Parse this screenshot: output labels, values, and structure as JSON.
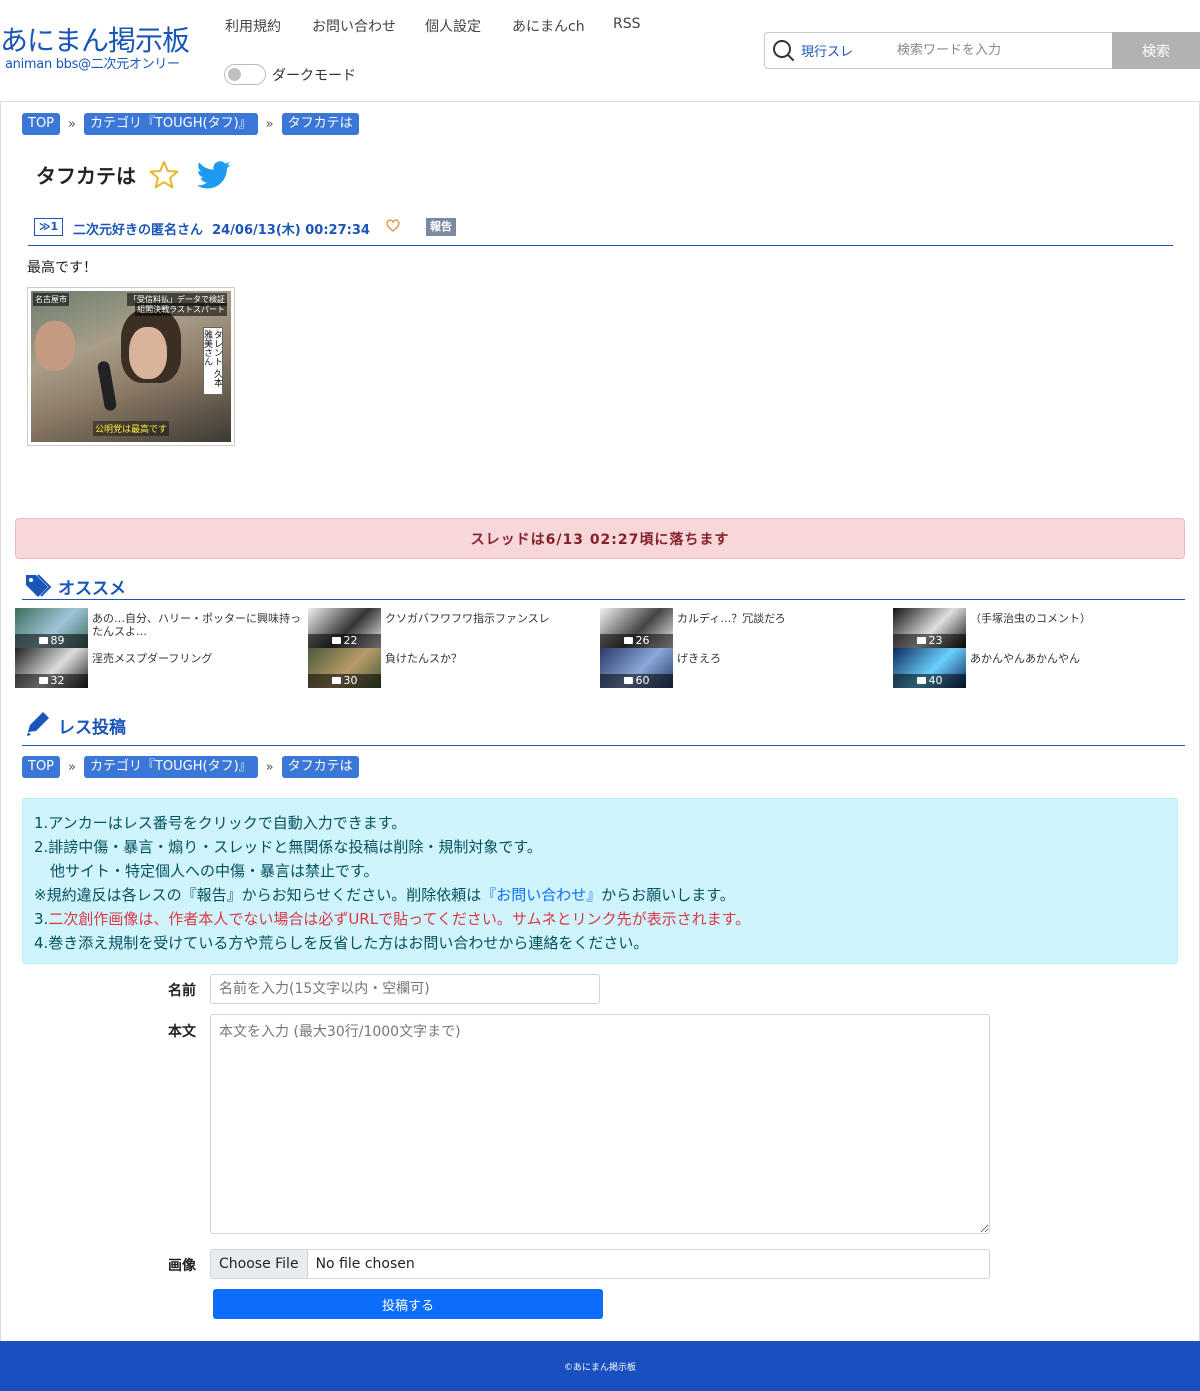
{
  "site": {
    "title": "あにまん掲示板",
    "subtitle": "animan bbs@二次元オンリー",
    "nav": [
      "利用規約",
      "お問い合わせ",
      "個人設定",
      "あにまんch",
      "RSS"
    ],
    "dark_mode_label": "ダークモード"
  },
  "search": {
    "scope_label": "現行スレ",
    "placeholder": "検索ワードを入力",
    "button_label": "検索"
  },
  "breadcrumb": [
    "TOP",
    "カテゴリ『TOUGH(タフ)』",
    "タフカテは"
  ],
  "breadcrumb_sep": "»",
  "thread": {
    "title": "タフカテは",
    "post": {
      "res_number": "1",
      "poster": "二次元好きの匿名さん",
      "date": "24/06/13(木) 00:27:34",
      "report_label": "報告",
      "body": "最高です！",
      "image": {
        "corner_text": "名古屋市",
        "top_text": "「受信料払」データで検証",
        "top_text2": "組閣決戦ラストスパート",
        "name_plate": "タレント 久本雅美さん",
        "caption": "公明党は最高です"
      }
    }
  },
  "expire_notice": "スレッドは6/13 02:27頃に落ちます",
  "recommend": {
    "heading": "オススメ",
    "items": [
      {
        "title": "あの…自分、ハリー・ポッターに興味持ったんスよ…",
        "count": "89",
        "color1": "#3a6e5a",
        "color2": "#9fc4d8"
      },
      {
        "title": "淫売メスプダーフリング",
        "count": "32",
        "color1": "#222222",
        "color2": "#dddddd"
      },
      {
        "title": "クソガバフワフワ指示ファンスレ",
        "count": "22",
        "color1": "#f0f0f0",
        "color2": "#333333"
      },
      {
        "title": "負けたんスか？",
        "count": "30",
        "color1": "#4a5a3a",
        "color2": "#b89a6a"
      },
      {
        "title": "カルディ…？冗談だろ",
        "count": "26",
        "color1": "#f2f2f2",
        "color2": "#444444"
      },
      {
        "title": "げきえろ",
        "count": "60",
        "color1": "#2a3a6a",
        "color2": "#8aa8d8"
      },
      {
        "title": "（手塚治虫のコメント）",
        "count": "23",
        "color1": "#111111",
        "color2": "#e0e0e0"
      },
      {
        "title": "あかんやんあかんやん",
        "count": "40",
        "color1": "#0d2a5a",
        "color2": "#6ad0ff"
      }
    ]
  },
  "reply": {
    "heading": "レス投稿",
    "rules": {
      "l1": "1.アンカーはレス番号をクリックで自動入力できます。",
      "l2": "2.誹謗中傷・暴言・煽り・スレッドと無関係な投稿は削除・規制対象です。",
      "l3": "他サイト・特定個人への中傷・暴言は禁止です。",
      "l4a": "※規約違反は各レスの『報告』からお知らせください。削除依頼は",
      "l4link": "『お問い合わせ』",
      "l4b": "からお願いします。",
      "l5a": "3.",
      "l5b": "二次創作画像は、作者本人でない場合は必ずURLで貼ってください。サムネとリンク先が表示されます。",
      "l6": "4.巻き添え規制を受けている方や荒らしを反省した方はお問い合わせから連絡をください。"
    },
    "name_label": "名前",
    "name_placeholder": "名前を入力(15文字以内・空欄可)",
    "body_label": "本文",
    "body_placeholder": "本文を入力 (最大30行/1000文字まで)",
    "image_label": "画像",
    "file_button": "Choose File",
    "file_status": "No file chosen",
    "submit_label": "投稿する"
  },
  "footer": "©あにまん掲示板",
  "colors": {
    "brand": "#1a56b8",
    "danger_bg": "#f8d7da",
    "info_bg": "#cff4fc",
    "primary_button": "#0d6efd",
    "footer_bg": "#1a4fbf"
  }
}
